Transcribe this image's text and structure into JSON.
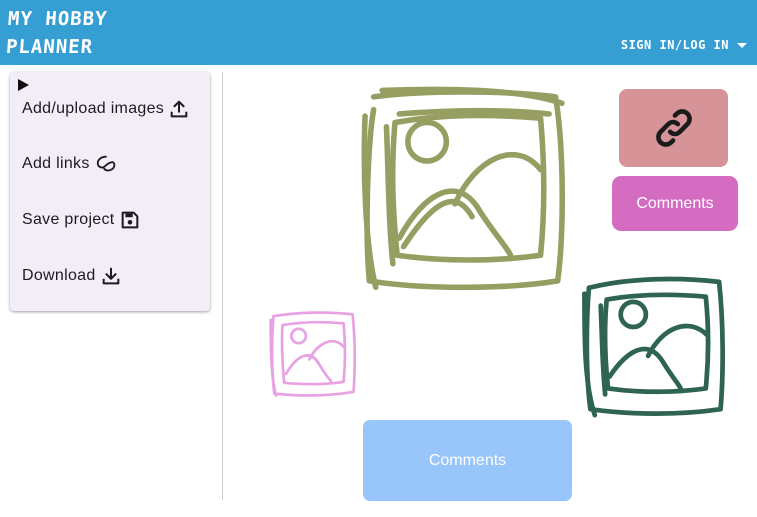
{
  "app": {
    "title": "MY HOBBY\nPLANNER",
    "signin_label": "SIGN IN/LOG IN"
  },
  "menu": {
    "items": [
      {
        "label": "Add/upload images",
        "icon": "upload-icon"
      },
      {
        "label": "Add links",
        "icon": "link-loop-icon"
      },
      {
        "label": "Save project",
        "icon": "save-icon"
      },
      {
        "label": "Download",
        "icon": "download-icon"
      }
    ]
  },
  "canvas": {
    "link_tile": {
      "icon": "link-icon",
      "color": "#d69398"
    },
    "comments_top": {
      "label": "Comments",
      "color": "#d46cc2"
    },
    "comments_bottom": {
      "label": "Comments",
      "color": "#98c5fa"
    },
    "images": [
      {
        "icon": "image-icon",
        "color": "#979e61"
      },
      {
        "icon": "image-icon",
        "color": "#e8a2e3"
      },
      {
        "icon": "image-icon",
        "color": "#2f6452"
      }
    ]
  }
}
